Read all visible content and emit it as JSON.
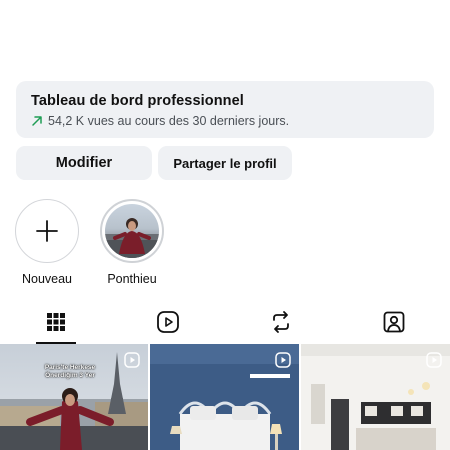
{
  "dashboard": {
    "title": "Tableau de bord professionnel",
    "stats": "54,2 K vues au cours des 30 derniers jours."
  },
  "actions": {
    "edit_label": "Modifier",
    "share_label": "Partager le profil"
  },
  "highlights": [
    {
      "label": "Nouveau",
      "icon": "plus-icon"
    },
    {
      "label": "Ponthieu",
      "icon": "story-cover"
    }
  ],
  "tabs": [
    {
      "icon": "grid-icon",
      "active": true
    },
    {
      "icon": "reels-icon",
      "active": false
    },
    {
      "icon": "repost-icon",
      "active": false
    },
    {
      "icon": "tagged-icon",
      "active": false
    }
  ],
  "posts": [
    {
      "caption": "Paris'te Herkese Önerdiğim 3 Yer",
      "badge": "reel-icon"
    },
    {
      "caption": "",
      "badge": "reel-icon"
    },
    {
      "caption": "",
      "badge": "reel-icon"
    }
  ],
  "colors": {
    "accent_green": "#1f9d55",
    "surface": "#eff1f4",
    "text": "#111111"
  }
}
